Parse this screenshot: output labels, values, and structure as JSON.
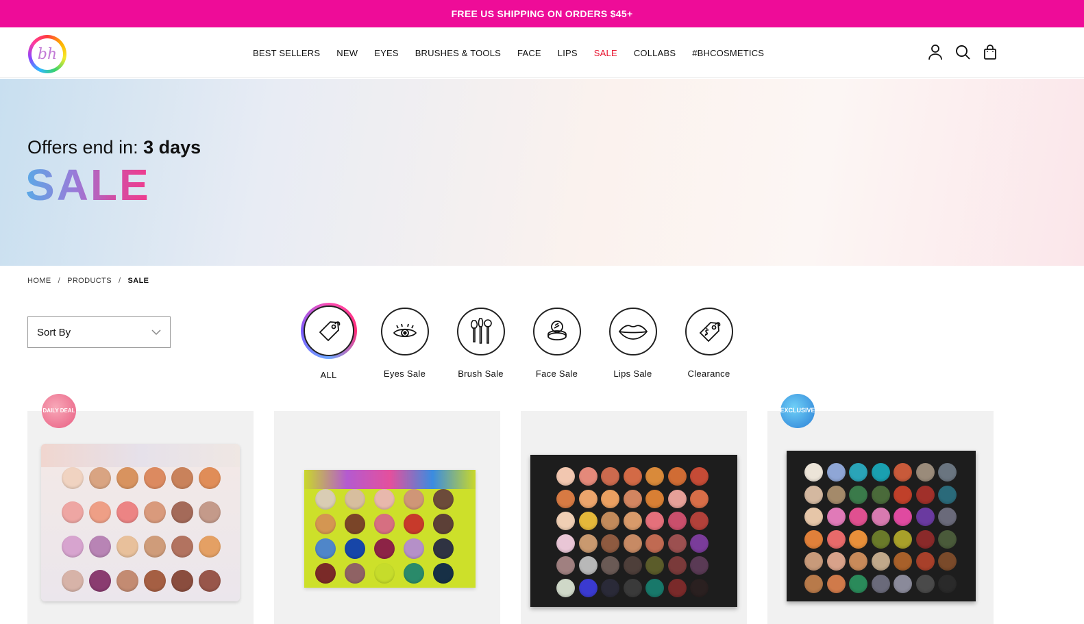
{
  "promo": {
    "text": "FREE US SHIPPING ON ORDERS $45+"
  },
  "header": {
    "logo_text": "bh",
    "nav": [
      {
        "label": "BEST SELLERS"
      },
      {
        "label": "NEW"
      },
      {
        "label": "EYES"
      },
      {
        "label": "BRUSHES & TOOLS"
      },
      {
        "label": "FACE"
      },
      {
        "label": "LIPS"
      },
      {
        "label": "SALE"
      },
      {
        "label": "COLLABS"
      },
      {
        "label": "#BHCOSMETICS"
      }
    ],
    "icons": [
      "account-icon",
      "search-icon",
      "bag-icon"
    ]
  },
  "hero": {
    "offers_prefix": "Offers end in: ",
    "offers_value": "3 days",
    "title": "SALE"
  },
  "breadcrumb": [
    {
      "label": "HOME"
    },
    {
      "label": "PRODUCTS"
    },
    {
      "label": "SALE"
    }
  ],
  "sort": {
    "label": "Sort By"
  },
  "categories": [
    {
      "label": "ALL",
      "icon": "tag-icon"
    },
    {
      "label": "Eyes Sale",
      "icon": "eye-icon"
    },
    {
      "label": "Brush Sale",
      "icon": "brushes-icon"
    },
    {
      "label": "Face Sale",
      "icon": "compact-icon"
    },
    {
      "label": "Lips Sale",
      "icon": "lips-icon"
    },
    {
      "label": "Clearance",
      "icon": "dollar-tag-icon"
    }
  ],
  "badges": {
    "daily_deal": "DAILY DEAL",
    "exclusive": "EXCLUSIVE"
  },
  "colors": {
    "promo_bg": "#ee0c98",
    "sale_nav": "#e8112d"
  }
}
